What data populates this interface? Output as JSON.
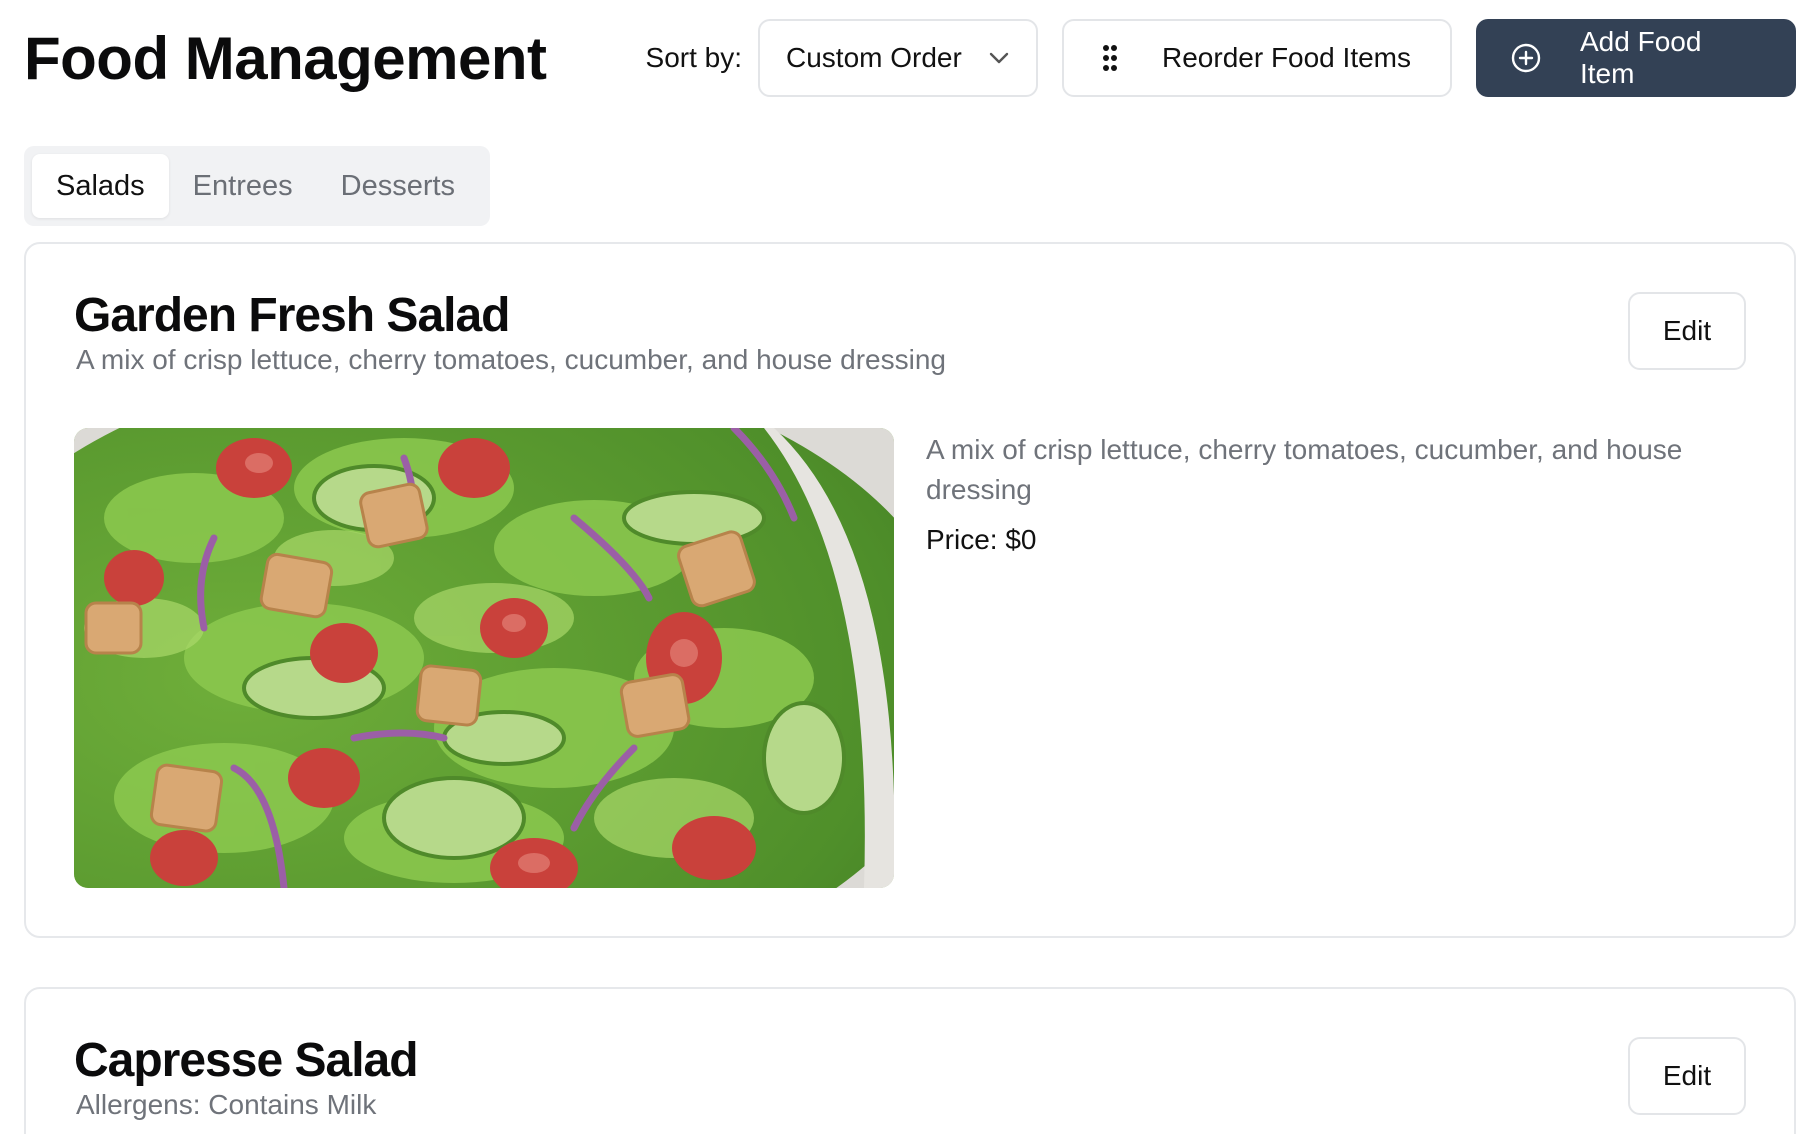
{
  "header": {
    "title": "Food Management",
    "sort_label": "Sort by:",
    "sort_value": "Custom Order",
    "reorder_label": "Reorder Food Items",
    "add_label": "Add Food Item"
  },
  "icons": {
    "sort": "chevron-down-icon",
    "reorder": "drag-handle-icon",
    "add": "plus-circle-icon"
  },
  "colors": {
    "primary_button": "#334155",
    "tab_bg": "#f1f2f4",
    "muted_text": "#6f737a"
  },
  "tabs": [
    {
      "label": "Salads",
      "active": true
    },
    {
      "label": "Entrees",
      "active": false
    },
    {
      "label": "Desserts",
      "active": false
    }
  ],
  "items": [
    {
      "name": "Garden Fresh Salad",
      "subtitle": "A mix of crisp lettuce, cherry tomatoes, cucumber, and house dressing",
      "edit_label": "Edit",
      "description": "A mix of crisp lettuce, cherry tomatoes, cucumber, and house dressing",
      "price_text": "Price: $0"
    },
    {
      "name": "Capresse Salad",
      "subtitle": "Allergens: Contains Milk",
      "edit_label": "Edit"
    }
  ]
}
